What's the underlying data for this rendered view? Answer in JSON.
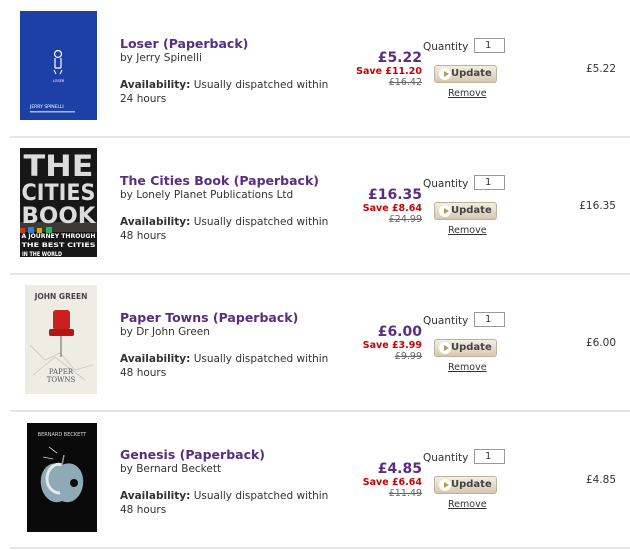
{
  "labels": {
    "quantity": "Quantity",
    "update": "Update",
    "remove": "Remove",
    "availability": "Availability:"
  },
  "items": [
    {
      "title": "Loser (Paperback)",
      "author": "by Jerry Spinelli",
      "availability": "Usually dispatched within 24 hours",
      "price": "£5.22",
      "save": "Save £11.20",
      "was": "£16.42",
      "quantity": "1",
      "line_total": "£5.22",
      "cover": {
        "author_text": "JERRY SPINELLI",
        "title_text": "LOSER",
        "color": "#1b3fa3"
      }
    },
    {
      "title": "The Cities Book (Paperback)",
      "author": "by Lonely Planet Publications Ltd",
      "availability": "Usually dispatched within 48 hours",
      "price": "£16.35",
      "save": "Save £8.64",
      "was": "£24.99",
      "quantity": "1",
      "line_total": "£16.35",
      "cover": {
        "lines": [
          "THE",
          "CITIES",
          "BOOK"
        ],
        "subtitle": "A JOURNEY THROUGH THE BEST CITIES IN THE WORLD",
        "color": "#1a1a1a"
      }
    },
    {
      "title": "Paper Towns (Paperback)",
      "author": "by Dr John Green",
      "availability": "Usually dispatched within 48 hours",
      "price": "£6.00",
      "save": "Save £3.99",
      "was": "£9.99",
      "quantity": "1",
      "line_total": "£6.00",
      "cover": {
        "author_text": "JOHN GREEN",
        "title_text": "PAPER TOWNS",
        "color": "#efeee6"
      }
    },
    {
      "title": "Genesis (Paperback)",
      "author": "by Bernard Beckett",
      "availability": "Usually dispatched within 48 hours",
      "price": "£4.85",
      "save": "Save £6.64",
      "was": "£11.49",
      "quantity": "1",
      "line_total": "£4.85",
      "cover": {
        "author_text": "BERNARD BECKETT",
        "color": "#0a0a0a"
      }
    }
  ]
}
